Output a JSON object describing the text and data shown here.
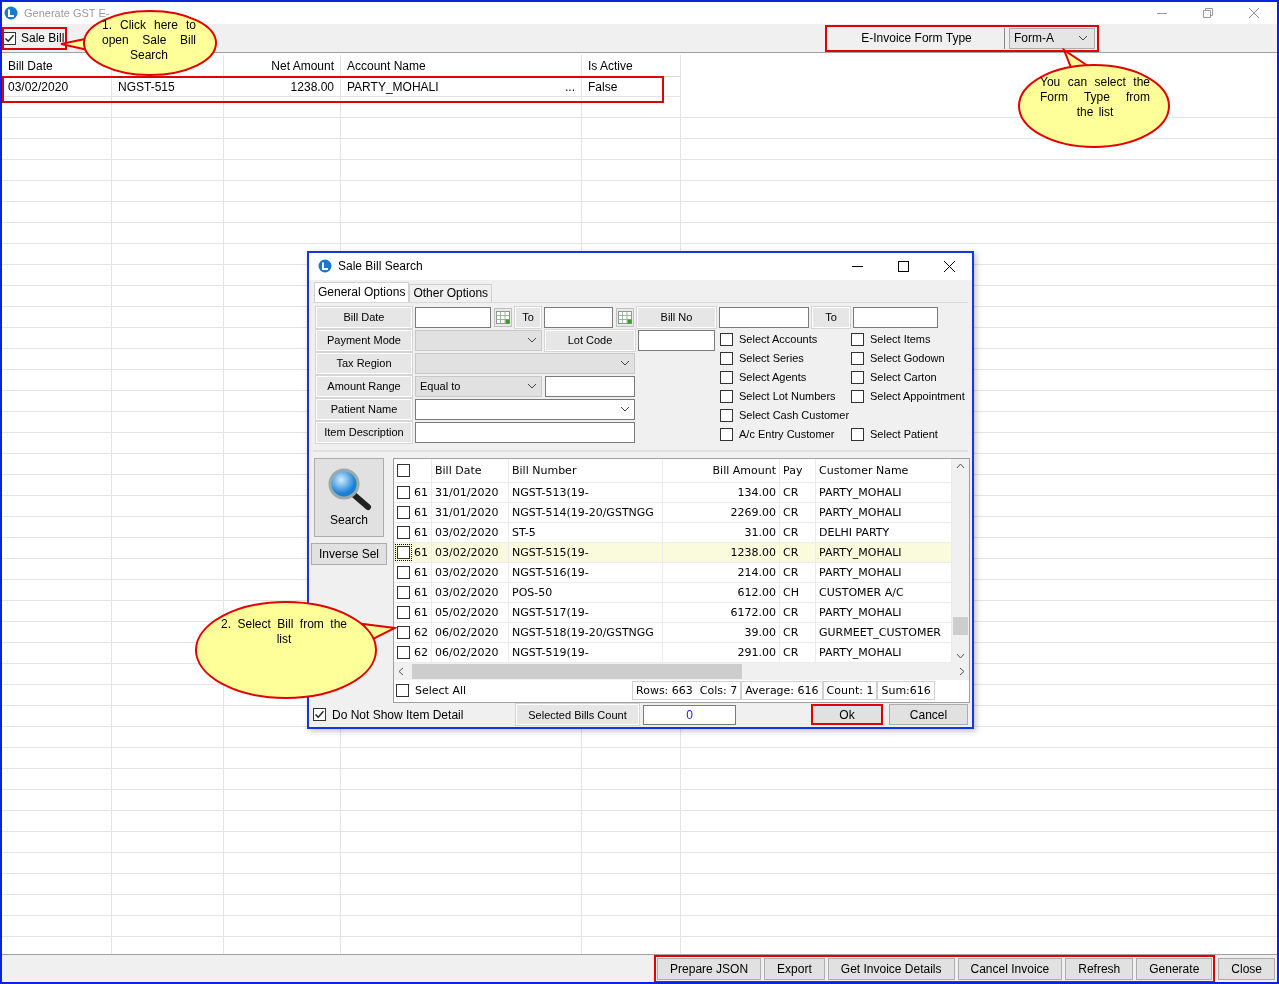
{
  "window": {
    "title": "Generate GST E-"
  },
  "toolbar": {
    "sale_bill": {
      "label": "Sale Bill",
      "checked": true,
      "highlighted": true
    },
    "form_type": {
      "label": "E-Invoice Form Type",
      "value": "Form-A",
      "highlighted": true
    }
  },
  "table": {
    "headers": {
      "bill_date": "Bill Date",
      "net_amount": "Net Amount",
      "account_name": "Account Name",
      "is_active": "Is Active"
    },
    "rows": [
      {
        "bill_date": "03/02/2020",
        "column_2": "NGST-515",
        "net_amount": "1238.00",
        "account_name": "PARTY_MOHALI",
        "account_more": "...",
        "is_active": "False",
        "highlighted": true
      }
    ]
  },
  "footer": {
    "highlighted": true,
    "buttons": [
      "Prepare JSON",
      "Export",
      "Get Invoice Details",
      "Cancel Invoice",
      "Refresh",
      "Generate"
    ],
    "close_button": "Close"
  },
  "dialog": {
    "title": "Sale Bill Search",
    "tabs": [
      {
        "label": "General Options",
        "selected": true
      },
      {
        "label": "Other Options",
        "selected": false
      }
    ],
    "filters": {
      "bill_date": {
        "label": "Bill Date",
        "to_label": "To"
      },
      "bill_no": {
        "label": "Bill No",
        "to_label": "To"
      },
      "payment_mode": {
        "label": "Payment Mode",
        "kind": "dropdown"
      },
      "lot_code": {
        "label": "Lot Code"
      },
      "tax_region": {
        "label": "Tax Region",
        "kind": "dropdown"
      },
      "amount_range": {
        "label": "Amount Range",
        "kind": "dropdown",
        "value": "Equal to"
      },
      "patient_name": {
        "label": "Patient Name",
        "kind": "combo"
      },
      "item_description": {
        "label": "Item Description"
      }
    },
    "options": [
      {
        "left": {
          "label": "Select Accounts",
          "checked": false
        },
        "right": {
          "label": "Select Items",
          "checked": false
        }
      },
      {
        "left": {
          "label": "Select Series",
          "checked": false
        },
        "right": {
          "label": "Select Godown",
          "checked": false
        }
      },
      {
        "left": {
          "label": "Select Agents",
          "checked": false
        },
        "right": {
          "label": "Select Carton",
          "checked": false
        }
      },
      {
        "left": {
          "label": "Select Lot Numbers",
          "checked": false
        },
        "right": {
          "label": "Select Appointment",
          "checked": false
        }
      },
      {
        "left": {
          "label": "Select Cash Customer",
          "checked": false
        }
      },
      {
        "left": {
          "label": "A/c Entry Customer",
          "checked": false
        },
        "right": {
          "label": "Select Patient",
          "checked": false
        }
      }
    ],
    "search_button": "Search",
    "inverse_button": "Inverse Sel",
    "grid": {
      "header_checked": false,
      "columns": {
        "bill_date": "Bill Date",
        "bill_number": "Bill Number",
        "bill_amount": "Bill Amount",
        "pay": "Pay",
        "customer_name": "Customer Name"
      },
      "rows": [
        {
          "serial": "61",
          "bill_date": "31/01/2020",
          "bill_number": "NGST-513(19-",
          "bill_amount": "134.00",
          "pay": "CR",
          "customer_name": "PARTY_MOHALI",
          "checked": false,
          "selected": false
        },
        {
          "serial": "61",
          "bill_date": "31/01/2020",
          "bill_number": "NGST-514(19-20/GSTNGG",
          "bill_amount": "2269.00",
          "pay": "CR",
          "customer_name": "PARTY_MOHALI",
          "checked": false,
          "selected": false
        },
        {
          "serial": "61",
          "bill_date": "03/02/2020",
          "bill_number": "ST-5",
          "bill_amount": "31.00",
          "pay": "CR",
          "customer_name": "DELHI PARTY",
          "checked": false,
          "selected": false
        },
        {
          "serial": "61",
          "bill_date": "03/02/2020",
          "bill_number": "NGST-515(19-",
          "bill_amount": "1238.00",
          "pay": "CR",
          "customer_name": "PARTY_MOHALI",
          "checked": false,
          "selected": true
        },
        {
          "serial": "61",
          "bill_date": "03/02/2020",
          "bill_number": "NGST-516(19-",
          "bill_amount": "214.00",
          "pay": "CR",
          "customer_name": "PARTY_MOHALI",
          "checked": false,
          "selected": false
        },
        {
          "serial": "61",
          "bill_date": "03/02/2020",
          "bill_number": "POS-50",
          "bill_amount": "612.00",
          "pay": "CH",
          "customer_name": "CUSTOMER A/C",
          "checked": false,
          "selected": false
        },
        {
          "serial": "61",
          "bill_date": "05/02/2020",
          "bill_number": "NGST-517(19-",
          "bill_amount": "6172.00",
          "pay": "CR",
          "customer_name": "PARTY_MOHALI",
          "checked": false,
          "selected": false
        },
        {
          "serial": "62",
          "bill_date": "06/02/2020",
          "bill_number": "NGST-518(19-20/GSTNGG",
          "bill_amount": "39.00",
          "pay": "CR",
          "customer_name": "GURMEET_CUSTOMER",
          "checked": false,
          "selected": false
        },
        {
          "serial": "62",
          "bill_date": "06/02/2020",
          "bill_number": "NGST-519(19-",
          "bill_amount": "291.00",
          "pay": "CR",
          "customer_name": "PARTY_MOHALI",
          "checked": false,
          "selected": false
        }
      ],
      "select_all": {
        "label": "Select All",
        "checked": false
      },
      "status": [
        "Rows: 663  Cols: 7",
        "Average: 616",
        "Count: 1",
        "Sum:616"
      ]
    },
    "item_detail": {
      "label": "Do Not Show Item Detail",
      "checked": true
    },
    "selected_count": {
      "label": "Selected Bills Count",
      "value": "0"
    },
    "ok_button": {
      "label": "Ok",
      "highlighted": true
    },
    "cancel_button": "Cancel"
  },
  "callouts": [
    {
      "text": "1. Click here to open Sale Bill Search"
    },
    {
      "text": "You can select the Form Type from the list"
    },
    {
      "text": "2. Select Bill from the list"
    }
  ]
}
